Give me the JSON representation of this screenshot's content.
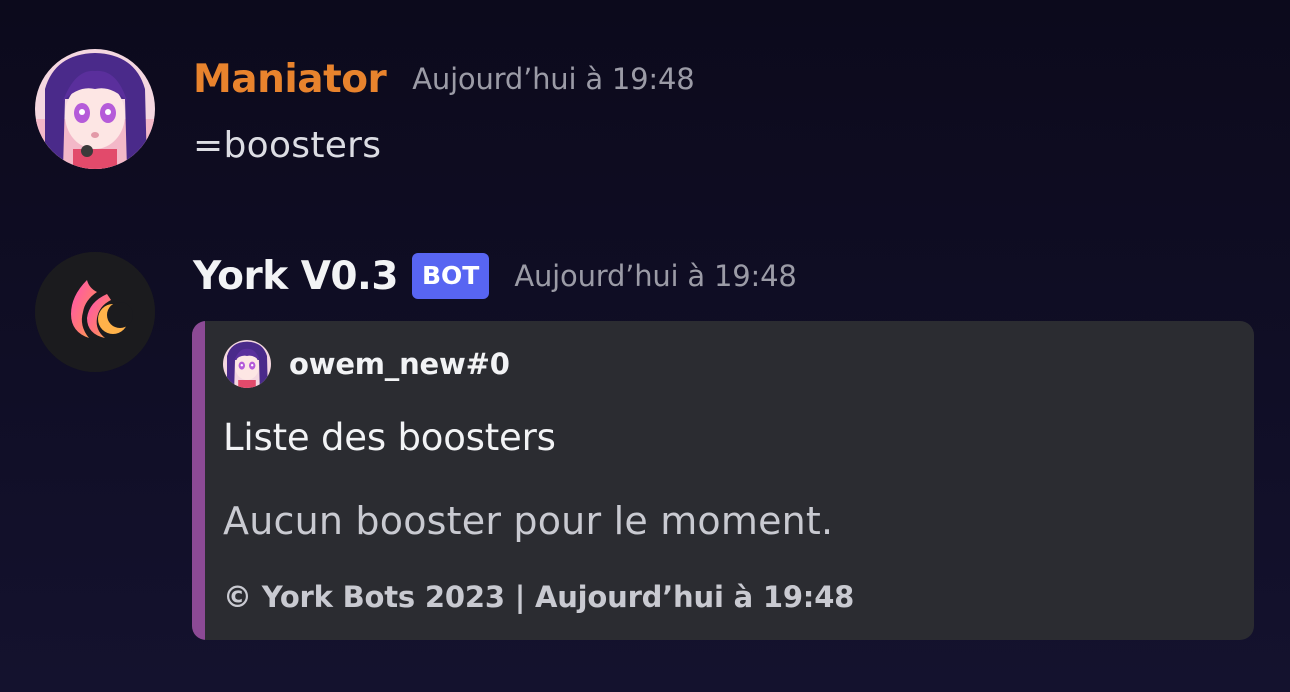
{
  "theme": {
    "username_user_color": "#e8832d",
    "username_bot_color": "#f2f3f5",
    "bot_badge_color": "#5865f2",
    "embed_accent_color": "#8c4a95",
    "embed_background": "#2b2c31"
  },
  "messages": [
    {
      "avatar_icon": "anime-girl-avatar",
      "username": "Maniator",
      "timestamp": "Aujourd’hui à 19:48",
      "content": "=boosters"
    },
    {
      "avatar_icon": "flame-moon-logo",
      "username": "York V0.3",
      "badge": "BOT",
      "timestamp": "Aujourd’hui à 19:48",
      "embed": {
        "author_icon": "anime-girl-avatar",
        "author_name": "owem_new#0",
        "title": "Liste des boosters",
        "description": "Aucun booster pour le moment.",
        "footer": "© York Bots 2023 | Aujourd’hui à 19:48"
      }
    }
  ]
}
